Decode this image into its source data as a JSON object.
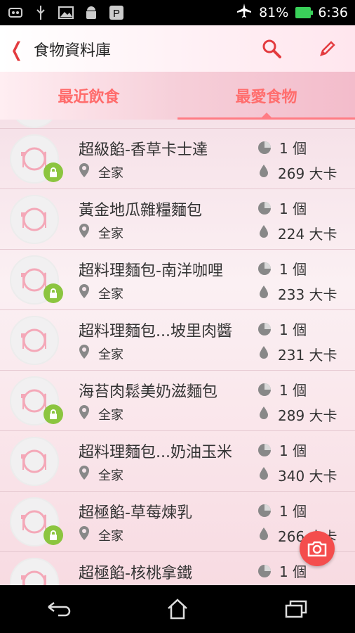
{
  "status": {
    "battery": "81%",
    "time": "6:36"
  },
  "header": {
    "title": "食物資料庫"
  },
  "tabs": [
    {
      "label": "最近飲食"
    },
    {
      "label": "最愛食物"
    }
  ],
  "items": [
    {
      "name": "超級餡-香草卡士達",
      "store": "全家",
      "qty": "1 個",
      "kcal": "269 大卡"
    },
    {
      "name": "黃金地瓜雜糧麵包",
      "store": "全家",
      "qty": "1 個",
      "kcal": "224 大卡"
    },
    {
      "name": "超料理麵包-南洋咖哩",
      "store": "全家",
      "qty": "1 個",
      "kcal": "233 大卡"
    },
    {
      "name": "超料理麵包...坡里肉醬",
      "store": "全家",
      "qty": "1 個",
      "kcal": "231 大卡"
    },
    {
      "name": "海苔肉鬆美奶滋麵包",
      "store": "全家",
      "qty": "1 個",
      "kcal": "289 大卡"
    },
    {
      "name": "超料理麵包...奶油玉米",
      "store": "全家",
      "qty": "1 個",
      "kcal": "340 大卡"
    },
    {
      "name": "超極餡-草莓煉乳",
      "store": "全家",
      "qty": "1 個",
      "kcal": "266 大卡"
    },
    {
      "name": "超極餡-核桃拿鐵",
      "store": "",
      "qty": "1 個",
      "kcal": ""
    }
  ]
}
